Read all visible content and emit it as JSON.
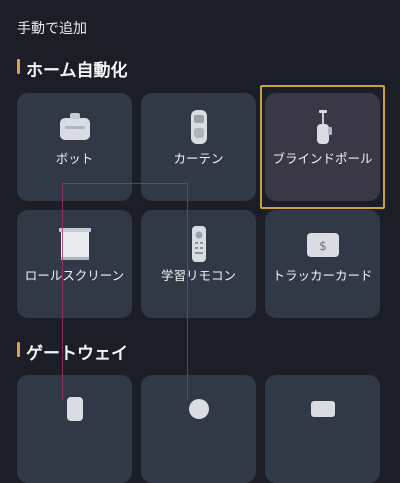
{
  "top_title": "手動で追加",
  "sections": {
    "home_automation": {
      "title": "ホーム自動化",
      "cards": [
        {
          "label": "ボット",
          "icon": "bot-icon"
        },
        {
          "label": "カーテン",
          "icon": "curtain-icon"
        },
        {
          "label": "ブラインドポール",
          "icon": "blind-pole-icon",
          "selected": true
        },
        {
          "label": "ロールスクリーン",
          "icon": "roller-shade-icon"
        },
        {
          "label": "学習リモコン",
          "icon": "remote-icon"
        },
        {
          "label": "トラッカーカード",
          "icon": "tracker-card-icon"
        }
      ]
    },
    "gateway": {
      "title": "ゲートウェイ"
    }
  }
}
